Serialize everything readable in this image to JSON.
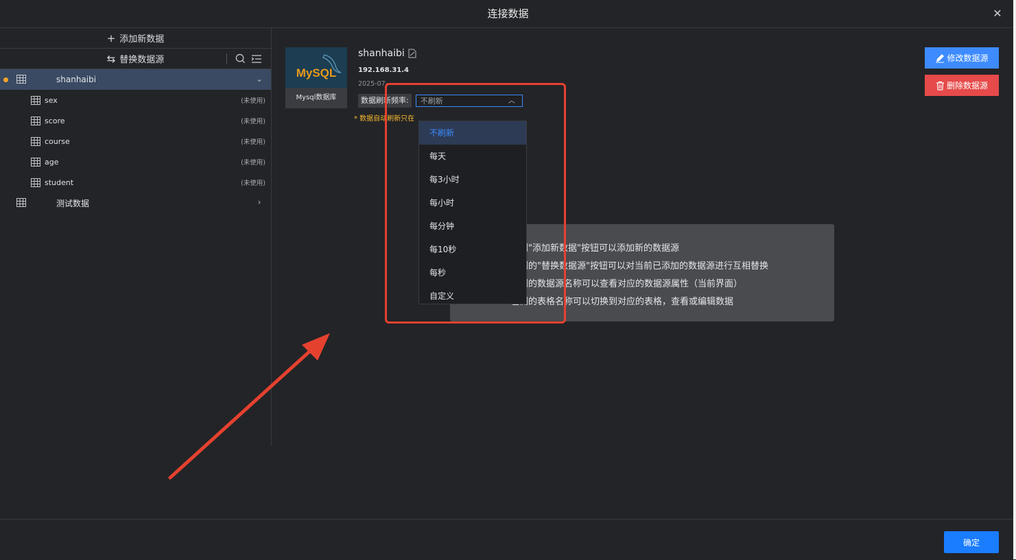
{
  "dialog": {
    "title": "连接数据"
  },
  "sidebar": {
    "add_label": "添加新数据",
    "replace_label": "替换数据源",
    "tree": [
      {
        "name": "shanhaibi",
        "active": true,
        "expanded": true,
        "children": [
          {
            "name": "sex",
            "status": "(未使用)"
          },
          {
            "name": "score",
            "status": "(未使用)"
          },
          {
            "name": "course",
            "status": "(未使用)"
          },
          {
            "name": "age",
            "status": "(未使用)"
          },
          {
            "name": "student",
            "status": "(未使用)"
          }
        ]
      },
      {
        "name": "测试数据",
        "active": false,
        "expanded": false
      }
    ]
  },
  "datasource": {
    "logo_text": "MySQL",
    "logo_caption": "Mysql数据库",
    "name": "shanhaibi",
    "host": "192.168.31.4",
    "date": "2025-07-",
    "refresh_label": "数据刷新频率:",
    "refresh_value": "不刷新",
    "note": "* 数据自动刷新只在"
  },
  "actions": {
    "edit_label": "修改数据源",
    "delete_label": "删除数据源"
  },
  "tips": [
    "左侧\"添加新数据\"按钮可以添加新的数据源",
    "左侧的\"替换数据源\"按钮可以对当前已添加的数据源进行互相替换",
    "左侧的数据源名称可以查看对应的数据源属性（当前界面）",
    "左侧的表格名称可以切换到对应的表格，查看或编辑数据"
  ],
  "dropdown": {
    "selected": "不刷新",
    "options": [
      "不刷新",
      "每天",
      "每3小时",
      "每小时",
      "每分钟",
      "每10秒",
      "每秒",
      "自定义"
    ]
  },
  "footer": {
    "ok_label": "确定"
  },
  "colors": {
    "primary": "#3d8bff",
    "danger": "#e64a4a",
    "highlight": "#e5412f",
    "active_dot": "#f5a524",
    "note": "#f5b82e"
  }
}
